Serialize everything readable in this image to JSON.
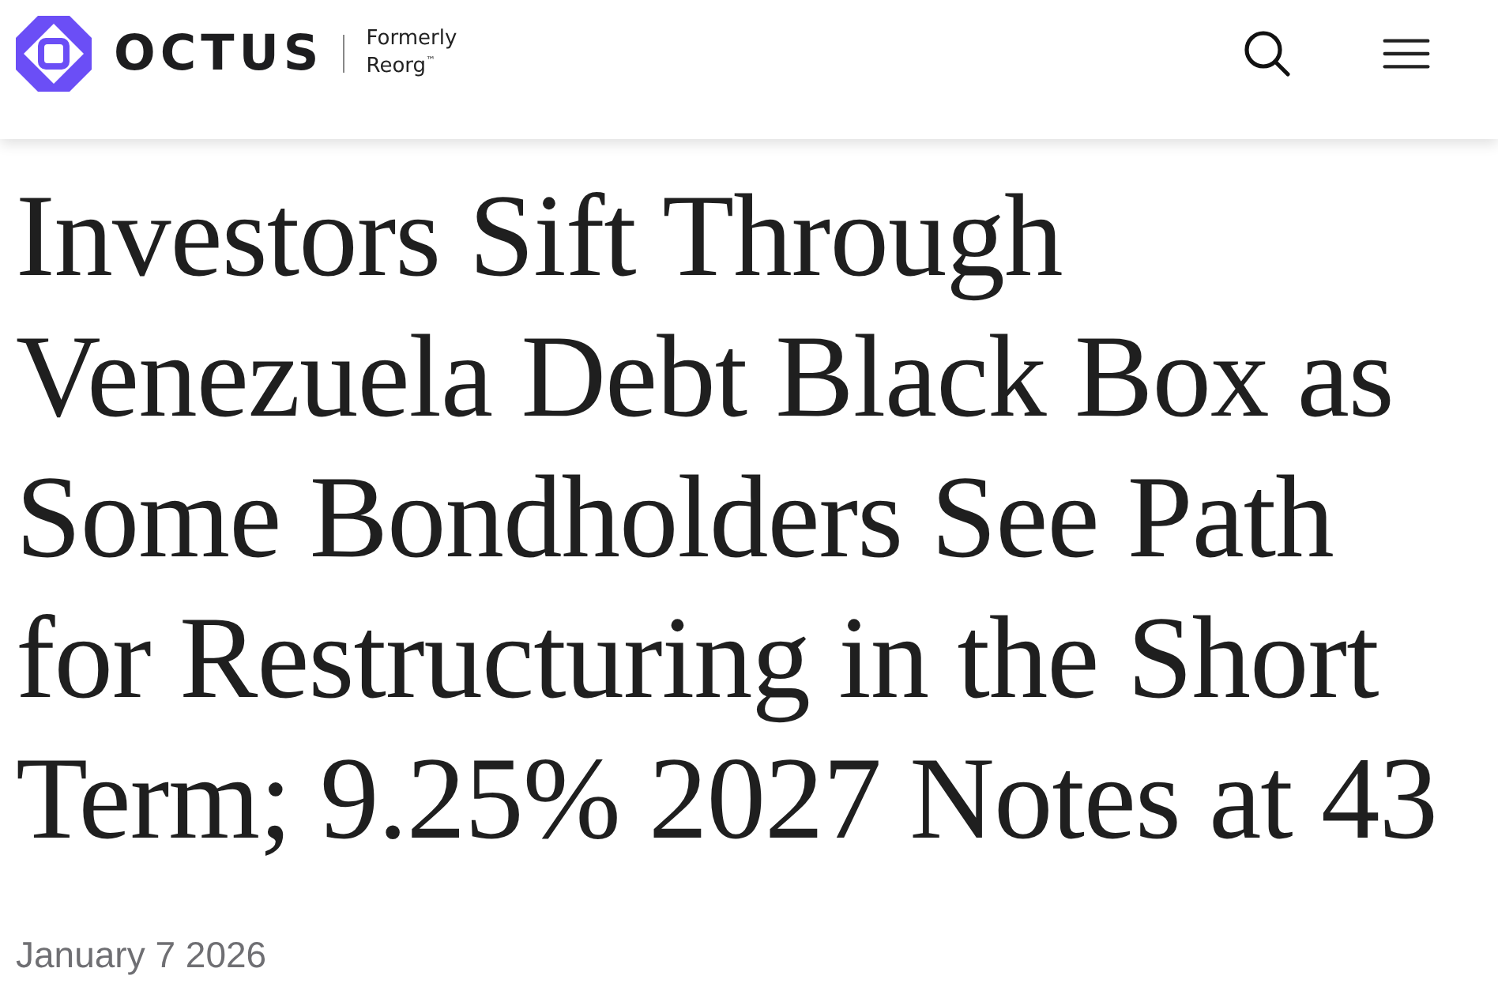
{
  "header": {
    "logo": {
      "wordmark": "OCTUS",
      "tagline": [
        "Formerly",
        "Reorg$^{™}$"
      ]
    }
  },
  "article": {
    "headline": "Investors Sift Through Venezuela Debt Black Box as Some Bondholders See Path for Restructuring in the Short Term; 9.25% 2027 Notes at 43",
    "date": "January 7 2026"
  }
}
